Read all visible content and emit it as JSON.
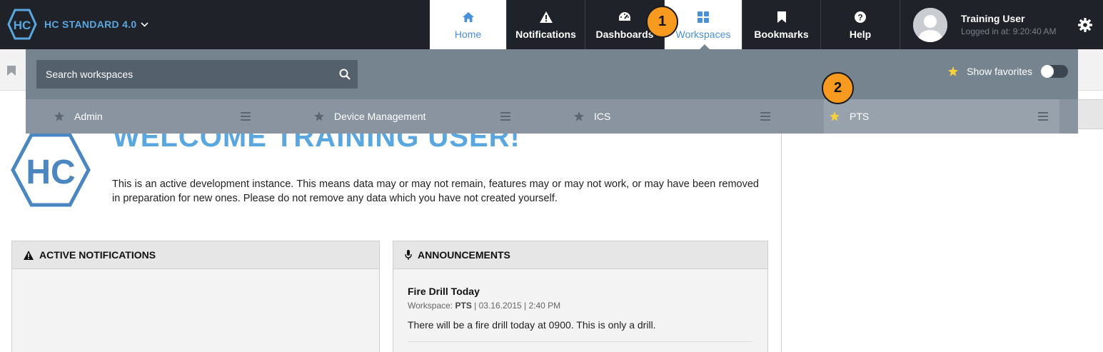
{
  "app": {
    "brand_text": "HC STANDARD 4.0",
    "logo_text": "HC"
  },
  "nav": {
    "items": [
      {
        "label": "Home",
        "icon": "home-icon",
        "active": true
      },
      {
        "label": "Notifications",
        "icon": "warning-icon",
        "active": false
      },
      {
        "label": "Dashboards",
        "icon": "dashboard-gauge-icon",
        "active": false
      },
      {
        "label": "Workspaces",
        "icon": "grid-icon",
        "active": true
      },
      {
        "label": "Bookmarks",
        "icon": "bookmark-icon",
        "active": false
      },
      {
        "label": "Help",
        "icon": "help-icon",
        "active": false
      }
    ]
  },
  "user": {
    "name": "Training User",
    "login_info": "Logged in at: 9:20:40 AM"
  },
  "workspaces_dropdown": {
    "search_placeholder": "Search workspaces",
    "show_favorites_label": "Show favorites",
    "show_favorites_on": false,
    "items": [
      {
        "label": "Admin",
        "favorite": false
      },
      {
        "label": "Device Management",
        "favorite": false
      },
      {
        "label": "ICS",
        "favorite": false
      },
      {
        "label": "PTS",
        "favorite": true
      }
    ]
  },
  "welcome": {
    "title": "WELCOME TRAINING USER!",
    "intro": "This is an active development instance. This means data may or may not remain, features may or may not work, or may have been removed in preparation for new ones. Please do not remove any data which you have not created yourself."
  },
  "panels": {
    "active_notifications_title": "ACTIVE NOTIFICATIONS",
    "announcements_title": "ANNOUNCEMENTS",
    "announcement": {
      "title": "Fire Drill Today",
      "workspace_label": "Workspace:",
      "workspace": "PTS",
      "meta_rest": "| 03.16.2015 | 2:40 PM",
      "text": "There will be a fire drill today at 0900. This is only a drill."
    }
  },
  "callouts": [
    "1",
    "2"
  ],
  "colors": {
    "topbar": "#1f2329",
    "accent": "#5aa7e0",
    "dropdown": "#76848f",
    "callout": "#f79a1f",
    "favorite_star": "#f5d13b"
  }
}
